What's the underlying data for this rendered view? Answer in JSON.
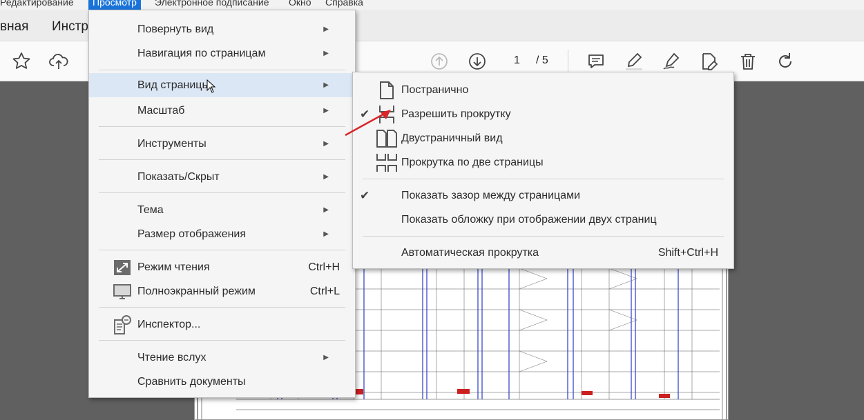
{
  "menubar": {
    "items": [
      "Редактирование",
      "Просмотр",
      "Электронное подписание",
      "Окно",
      "Справка"
    ]
  },
  "tabs": [
    "вная",
    "Инстр"
  ],
  "toolbar": {
    "page_current": "1",
    "page_total": "/ 5"
  },
  "view_menu": {
    "items": [
      {
        "label": "Повернуть вид",
        "submenu": true
      },
      {
        "label": "Навигация по страницам",
        "submenu": true
      },
      {
        "label": "Вид страницы",
        "submenu": true,
        "highlighted": true
      },
      {
        "label": "Масштаб",
        "submenu": true
      },
      {
        "label": "Инструменты",
        "submenu": true
      },
      {
        "label": "Показать/Скрыт",
        "submenu": true
      },
      {
        "label": "Тема",
        "submenu": true
      },
      {
        "label": "Размер отображения",
        "submenu": true
      },
      {
        "label": "Режим чтения",
        "shortcut": "Ctrl+H",
        "icon": "expand-icon"
      },
      {
        "label": "Полноэкранный режим",
        "shortcut": "Ctrl+L",
        "icon": "monitor-icon"
      },
      {
        "label": "Инспектор...",
        "icon": "inspector-icon"
      },
      {
        "label": "Чтение вслух",
        "submenu": true
      },
      {
        "label": "Сравнить документы"
      }
    ]
  },
  "page_view_submenu": {
    "items": [
      {
        "label": "Постранично",
        "icon": "single-page-icon"
      },
      {
        "label": "Разрешить прокрутку",
        "icon": "scroll-page-icon",
        "checked": true
      },
      {
        "label": "Двустраничный вид",
        "icon": "two-page-icon"
      },
      {
        "label": "Прокрутка по две страницы",
        "icon": "two-page-scroll-icon"
      },
      {
        "label": "Показать зазор между страницами",
        "checked": true
      },
      {
        "label": "Показать обложку при отображении двух страниц"
      },
      {
        "label": "Автоматическая прокрутка",
        "shortcut": "Shift+Ctrl+H"
      }
    ]
  },
  "colors": {
    "accent": "#1a73d9",
    "menu_bg": "#f5f5f5",
    "highlight": "#dce7f5",
    "annotation_arrow": "#d9252a"
  }
}
